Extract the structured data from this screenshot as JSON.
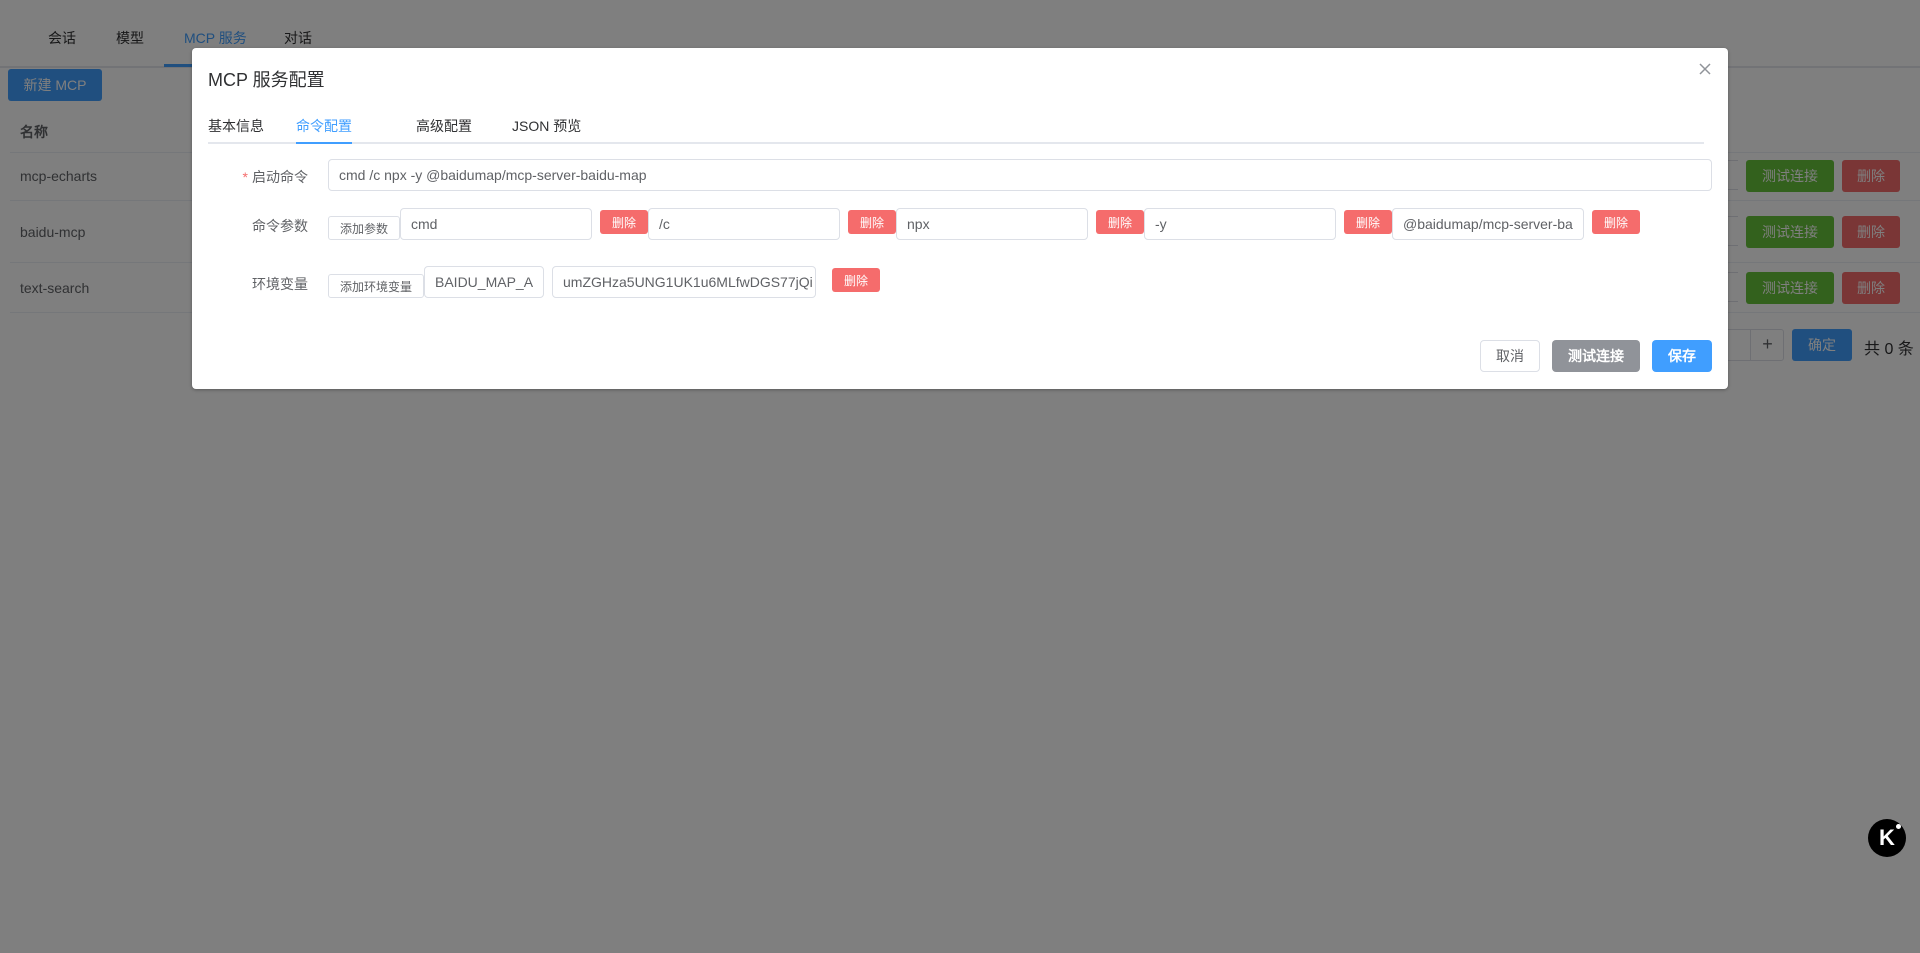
{
  "top_tabs": [
    {
      "label": "会话"
    },
    {
      "label": "模型"
    },
    {
      "label": "MCP 服务"
    },
    {
      "label": "对话"
    }
  ],
  "new_button_label": "新建 MCP",
  "table": {
    "name_header": "名称",
    "rows": [
      {
        "name": "mcp-echarts",
        "test_label": "测试连接",
        "delete_label": "删除"
      },
      {
        "name": "baidu-mcp",
        "test_label": "测试连接",
        "delete_label": "删除"
      },
      {
        "name": "text-search",
        "test_label": "测试连接",
        "delete_label": "删除"
      }
    ]
  },
  "pagination": {
    "plus_symbol": "+",
    "confirm_label": "确定",
    "total_text": "共 0 条"
  },
  "dialog": {
    "title": "MCP 服务配置",
    "tabs": [
      {
        "label": "基本信息"
      },
      {
        "label": "命令配置"
      },
      {
        "label": "高级配置"
      },
      {
        "label": "JSON 预览"
      }
    ],
    "active_tab": "命令配置",
    "form": {
      "start_command": {
        "required_mark": "*",
        "label": "启动命令",
        "value": "cmd /c npx -y @baidumap/mcp-server-baidu-map"
      },
      "command_args": {
        "label": "命令参数",
        "add_label": "添加参数",
        "delete_label": "删除",
        "args": [
          "cmd",
          "/c",
          "npx",
          "-y",
          "@baidumap/mcp-server-ba"
        ]
      },
      "env_vars": {
        "label": "环境变量",
        "add_label": "添加环境变量",
        "delete_label": "删除",
        "key": "BAIDU_MAP_A",
        "value": "umZGHza5UNG1UK1u6MLfwDGS77jQi"
      }
    },
    "footer": {
      "cancel_label": "取消",
      "test_label": "测试连接",
      "save_label": "保存"
    }
  },
  "floating_badge": "K",
  "colors": {
    "primary": "#409eff",
    "success": "#67c23a",
    "danger": "#f56c6c",
    "info": "#909399",
    "overlay": "rgba(0,0,0,0.5)"
  },
  "icons": [
    "close-icon",
    "plus-icon"
  ]
}
